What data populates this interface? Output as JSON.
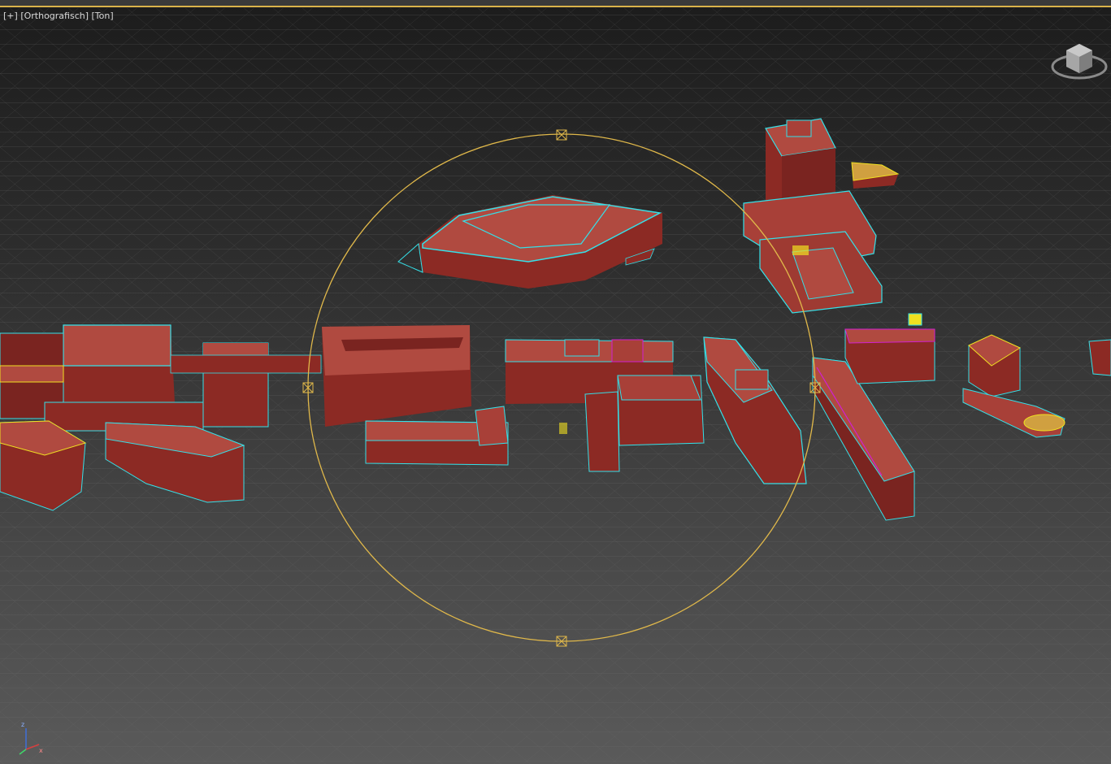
{
  "viewport": {
    "label_plus": "[+]",
    "label_view": "[Orthografisch]",
    "label_shading": "[Ton]"
  },
  "colors": {
    "building_face": "#8c2a24",
    "building_roof": "#b04a40",
    "building_dark": "#6a1f1b",
    "outline_cyan": "#35e0e8",
    "outline_magenta": "#d020d0",
    "outline_yellow": "#f0e020",
    "gizmo_circle": "#e0b84a",
    "grid_line": "#6e6e6e",
    "viewport_border": "#d9b24a"
  },
  "icons": {
    "viewcube": "viewcube-icon",
    "axis": "axis-tripod-icon",
    "gizmo_handle": "gizmo-handle-icon"
  },
  "axis_labels": {
    "z": "z",
    "x": "x"
  }
}
